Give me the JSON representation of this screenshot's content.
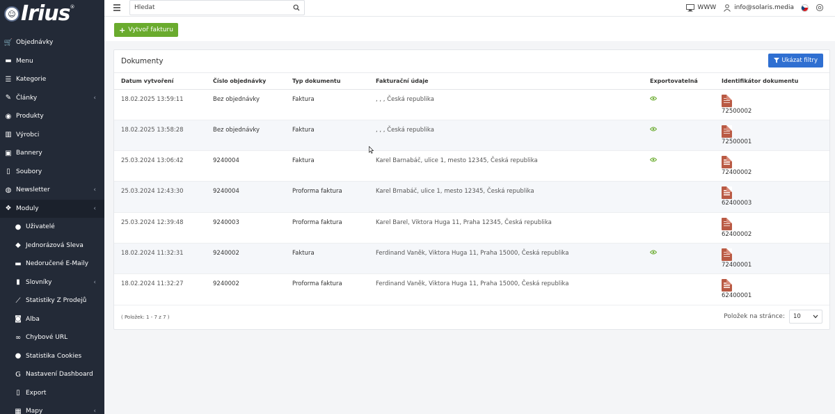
{
  "app": {
    "logo_text": "Irius",
    "logo_reg": "®"
  },
  "sidebar": {
    "items": [
      {
        "label": "Objednávky",
        "icon": "cart-icon",
        "arrow": false,
        "sub": false
      },
      {
        "label": "Menu",
        "icon": "folder-icon",
        "arrow": false,
        "sub": false
      },
      {
        "label": "Kategorie",
        "icon": "list-icon",
        "arrow": false,
        "sub": false
      },
      {
        "label": "Články",
        "icon": "pencil-icon",
        "arrow": true,
        "sub": false
      },
      {
        "label": "Produkty",
        "icon": "box-icon",
        "arrow": false,
        "sub": false
      },
      {
        "label": "Výrobci",
        "icon": "factory-icon",
        "arrow": false,
        "sub": false
      },
      {
        "label": "Bannery",
        "icon": "image-icon",
        "arrow": false,
        "sub": false
      },
      {
        "label": "Soubory",
        "icon": "file-icon",
        "arrow": false,
        "sub": false
      },
      {
        "label": "Newsletter",
        "icon": "newsletter-icon",
        "arrow": true,
        "sub": false
      },
      {
        "label": "Moduly",
        "icon": "dropbox-icon",
        "arrow": true,
        "sub": false,
        "active": true
      },
      {
        "label": "Uživatelé",
        "icon": "user-icon",
        "arrow": false,
        "sub": true
      },
      {
        "label": "Jednorázová Sleva",
        "icon": "tags-icon",
        "arrow": false,
        "sub": true
      },
      {
        "label": "Nedoručené E-Maily",
        "icon": "envelope-icon",
        "arrow": false,
        "sub": true
      },
      {
        "label": "Slovníky",
        "icon": "book-icon",
        "arrow": true,
        "sub": true
      },
      {
        "label": "Statistiky Z Prodejů",
        "icon": "chart-icon",
        "arrow": false,
        "sub": true
      },
      {
        "label": "Alba",
        "icon": "camera-icon",
        "arrow": false,
        "sub": true
      },
      {
        "label": "Chybové URL",
        "icon": "link-icon",
        "arrow": false,
        "sub": true
      },
      {
        "label": "Statistika Cookies",
        "icon": "cookie-icon",
        "arrow": false,
        "sub": true
      },
      {
        "label": "Nastavení Dashboard",
        "icon": "google-icon",
        "arrow": false,
        "sub": true
      },
      {
        "label": "Export",
        "icon": "export-icon",
        "arrow": false,
        "sub": true
      },
      {
        "label": "Mapy",
        "icon": "map-icon",
        "arrow": true,
        "sub": true
      }
    ]
  },
  "topbar": {
    "search_placeholder": "Hledat",
    "www_label": "WWW",
    "user_email": "info@solaris.media"
  },
  "actions": {
    "create_invoice": "Vytvoř fakturu"
  },
  "documents": {
    "title": "Dokumenty",
    "filter_button": "Ukázat filtry",
    "columns": [
      "Datum vytvoření",
      "Číslo objednávky",
      "Typ dokumentu",
      "Fakturační údaje",
      "Exportovatelná",
      "Identifikátor dokumentu"
    ],
    "rows": [
      {
        "date": "18.02.2025 13:59:11",
        "order": "Bez objednávky",
        "type": "Faktura",
        "billing": ", , , Česká republika",
        "exportable": true,
        "doc_id": "72500002"
      },
      {
        "date": "18.02.2025 13:58:28",
        "order": "Bez objednávky",
        "type": "Faktura",
        "billing": ", , , Česká republika",
        "exportable": true,
        "doc_id": "72500001"
      },
      {
        "date": "25.03.2024 13:06:42",
        "order": "9240004",
        "type": "Faktura",
        "billing": "Karel Barnabáč, ulice 1, mesto 12345, Česká republika",
        "exportable": true,
        "doc_id": "72400002"
      },
      {
        "date": "25.03.2024 12:43:30",
        "order": "9240004",
        "type": "Proforma faktura",
        "billing": "Karel Brnabáč, ulice 1, mesto 12345, Česká republika",
        "exportable": false,
        "doc_id": "62400003"
      },
      {
        "date": "25.03.2024 12:39:48",
        "order": "9240003",
        "type": "Proforma faktura",
        "billing": "Karel Barel, Viktora Huga 11, Praha 12345, Česká republika",
        "exportable": false,
        "doc_id": "62400002"
      },
      {
        "date": "18.02.2024 11:32:31",
        "order": "9240002",
        "type": "Faktura",
        "billing": "Ferdinand Vaněk, Viktora Huga 11, Praha 15000, Česká republika",
        "exportable": true,
        "doc_id": "72400001"
      },
      {
        "date": "18.02.2024 11:32:27",
        "order": "9240002",
        "type": "Proforma faktura",
        "billing": "Ferdinand Vaněk, Viktora Huga 11, Praha 15000, Česká republika",
        "exportable": false,
        "doc_id": "62400001"
      }
    ],
    "pagination_info": "( Položek: 1 - 7 z 7 )",
    "per_page_label": "Položek na stránce:",
    "per_page_value": "10"
  },
  "colors": {
    "sidebar_bg": "#232a37",
    "create_button": "#6aab2e",
    "filter_button": "#2f6fd1",
    "eye_icon": "#6aab2e",
    "doc_icon": "#b95a44"
  }
}
